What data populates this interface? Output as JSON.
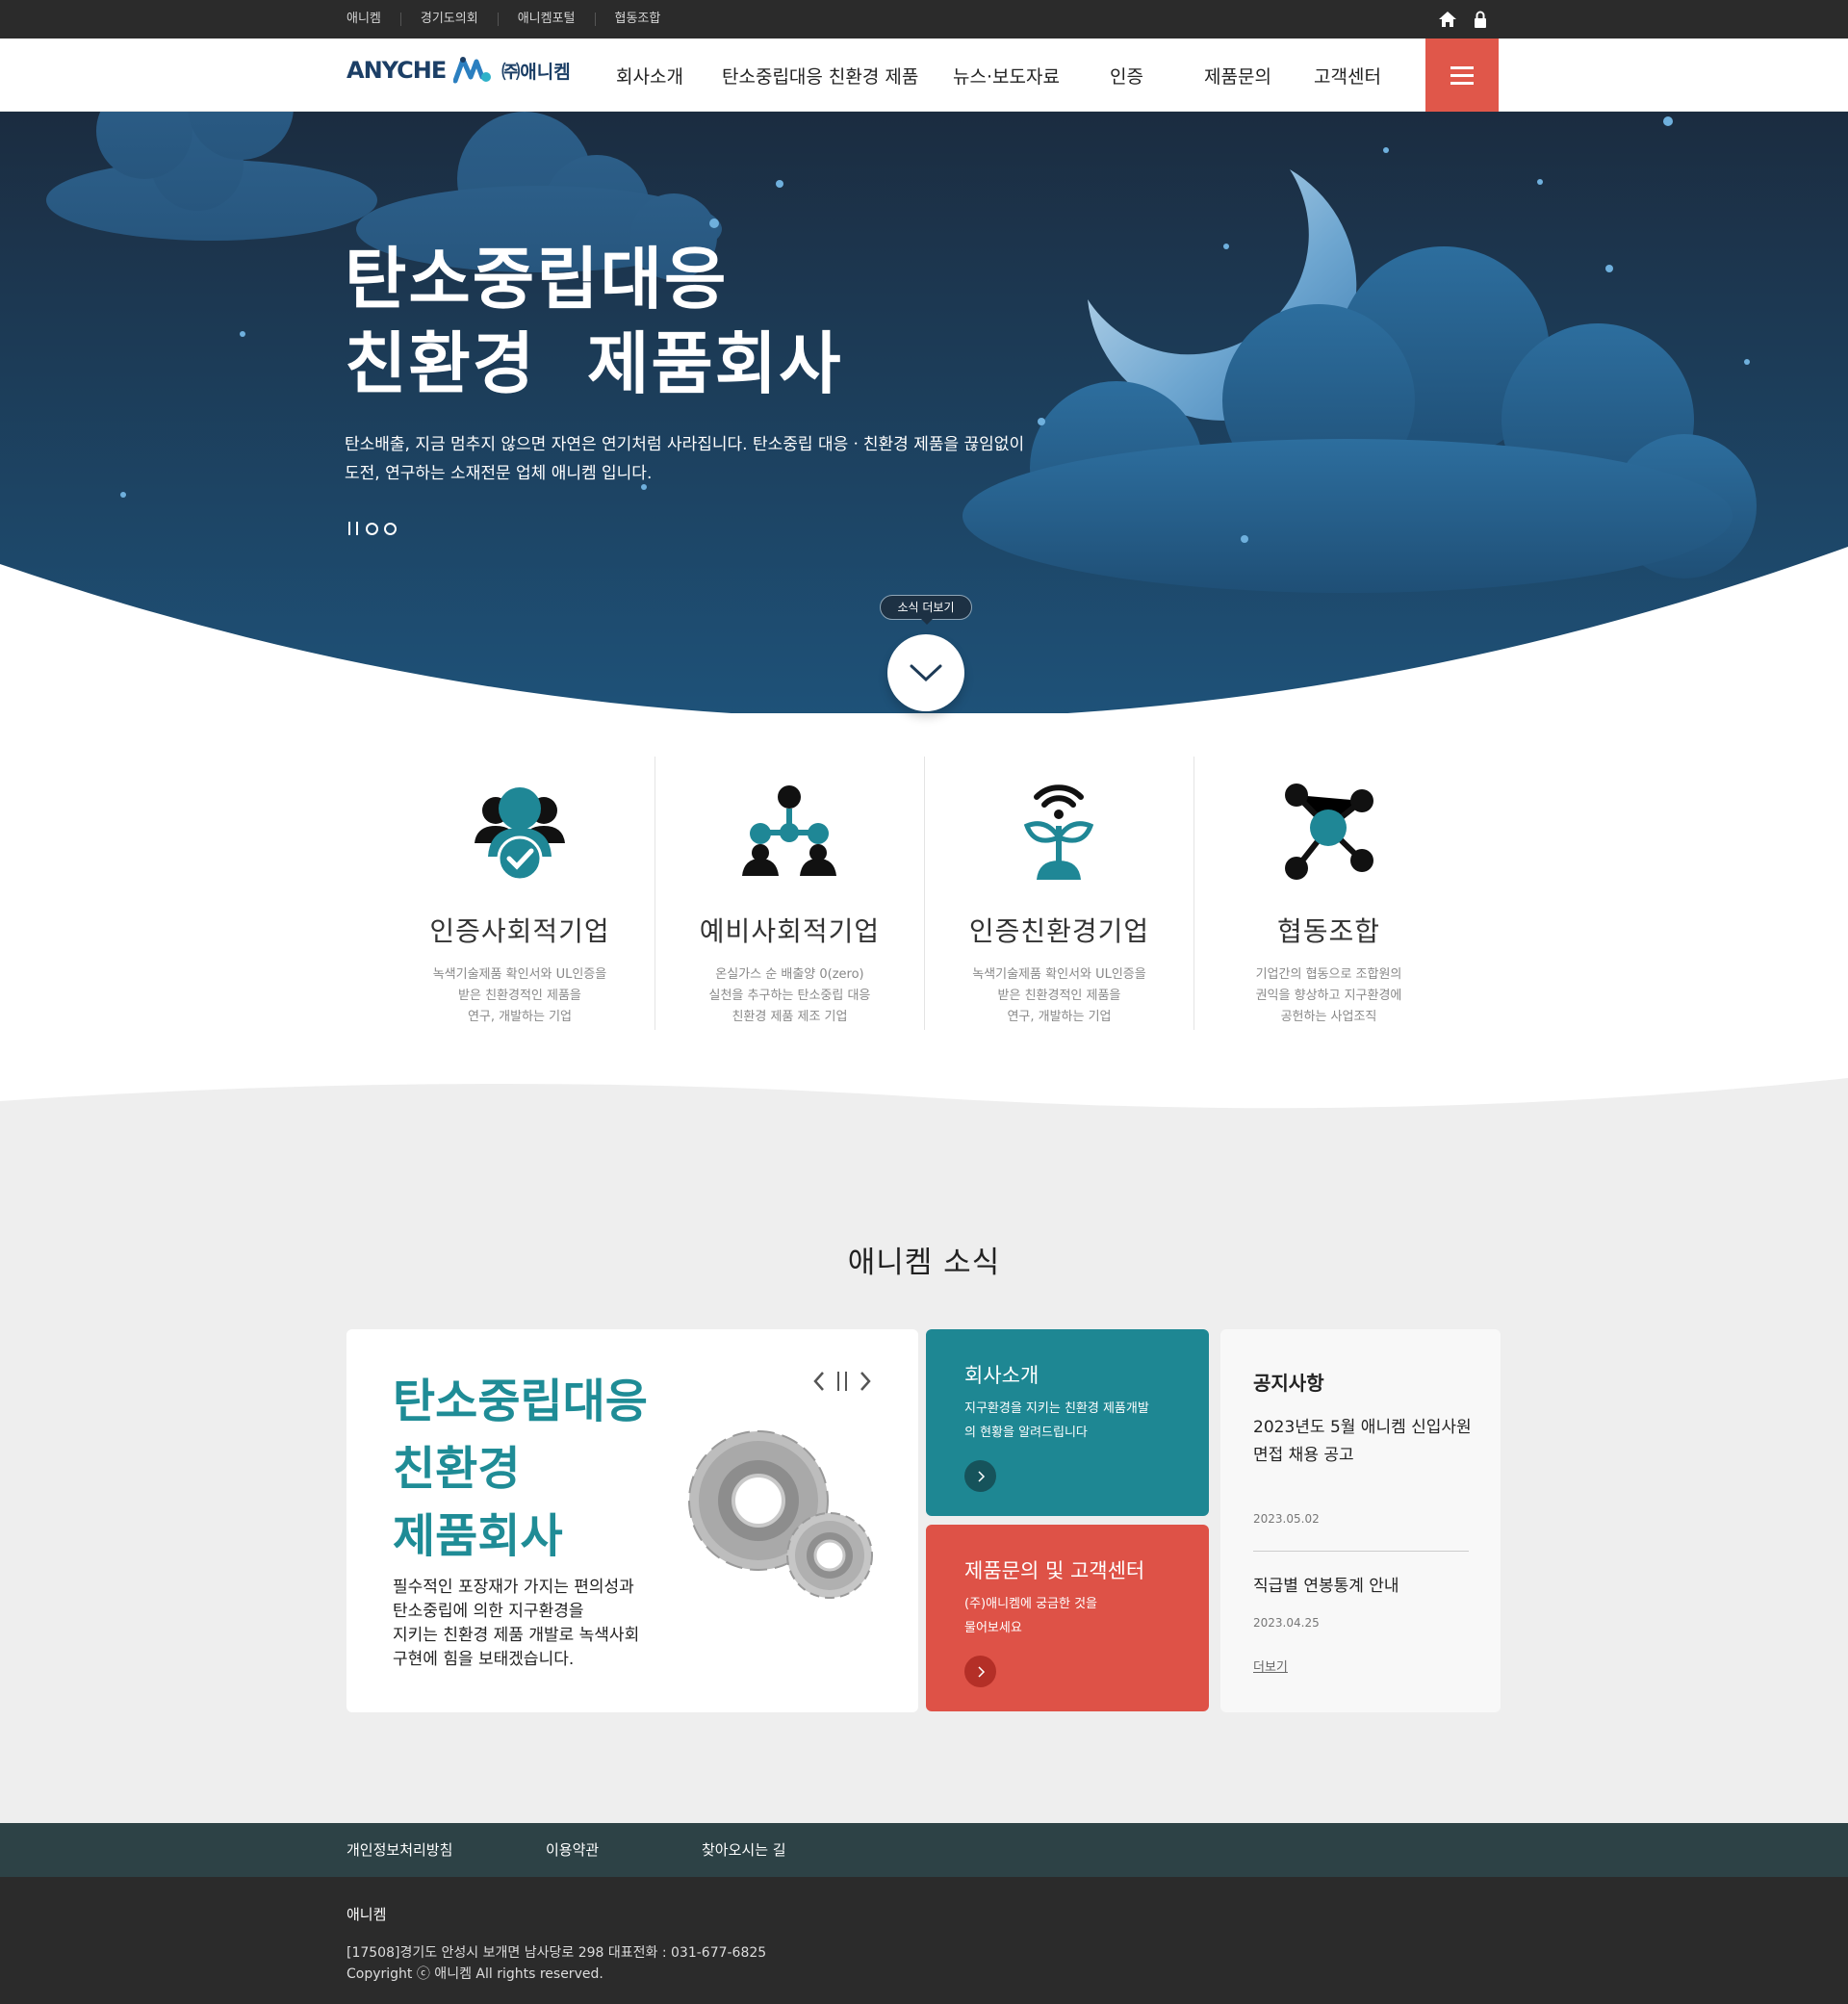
{
  "topbar": {
    "links": [
      "애니켐",
      "경기도의회",
      "애니켐포털",
      "협동조합"
    ],
    "icons": [
      "home-icon",
      "lock-icon"
    ]
  },
  "header": {
    "logo_en": "ANYCHE",
    "logo_ko": "㈜애니켐",
    "menu": [
      "회사소개",
      "탄소중립대응 친환경 제품",
      "뉴스·보도자료",
      "인증",
      "제품문의",
      "고객센터"
    ],
    "menu_icon": "hamburger-icon",
    "accent_color": "#e0574a"
  },
  "hero": {
    "title_line1": "탄소중립대응",
    "title_line2": "친환경  제품회사",
    "description": "탄소배출, 지금 멈추지 않으면 자연은 연기처럼 사라집니다. 탄소중립 대응ㆍ친환경 제품을 끊임없이 도전, 연구하는 소재전문 업체 애니켐 입니다.",
    "more_label": "소식 더보기",
    "bg_color": "#1d3a56"
  },
  "features": [
    {
      "icon": "certified-people-icon",
      "title": "인증사회적기업",
      "desc": "녹색기술제품 확인서와 UL인증을\n받은 친환경적인 제품을\n연구, 개발하는 기업"
    },
    {
      "icon": "network-people-icon",
      "title": "예비사회적기업",
      "desc": "온실가스 순 배출양 0(zero)\n실천을 추구하는 탄소중립 대응\n친환경 제품 제조 기업"
    },
    {
      "icon": "eco-sprout-icon",
      "title": "인증친환경기업",
      "desc": "녹색기술제품 확인서와 UL인증을\n받은 친환경적인 제품을\n연구, 개발하는 기업"
    },
    {
      "icon": "cooperative-network-icon",
      "title": "협동조합",
      "desc": "기업간의 협동으로 조합원의\n권익을 향상하고 지구환경에\n공헌하는 사업조직"
    }
  ],
  "news": {
    "section_title": "애니켐 소식",
    "main_card": {
      "headline": "탄소중립대응\n친환경\n제품회사",
      "text": "필수적인 포장재가 가지는 편의성과\n탄소중립에 의한 지구환경을\n지키는 친환경 제품 개발로 녹색사회\n구현에 힘을 보태겠습니다.",
      "accent_color": "#1f8c96"
    },
    "blue_card": {
      "title": "회사소개",
      "desc": "지구환경을 지키는 친환경 제품개발\n의 현황을 알려드립니다",
      "color": "#1e8793"
    },
    "red_card": {
      "title": "제품문의 및 고객센터",
      "desc": "(주)애니켐에 궁금한 것을\n물어보세요",
      "color": "#de5247"
    },
    "notice": {
      "title": "공지사항",
      "items": [
        {
          "title": "2023년도 5월 애니켐 신입사원\n면접 채용 공고",
          "date": "2023.05.02"
        },
        {
          "title": "직급별 연봉통계 안내",
          "date": "2023.04.25"
        }
      ],
      "more": "더보기"
    }
  },
  "footer": {
    "links": [
      "개인정보처리방침",
      "이용약관",
      "찾아오시는 길"
    ],
    "company": "애니켐",
    "address": "[17508]경기도 안성시 보개면 남사당로 298 대표전화 : 031-677-6825",
    "copyright": "Copyright ⓒ 애니켐 All rights reserved."
  }
}
